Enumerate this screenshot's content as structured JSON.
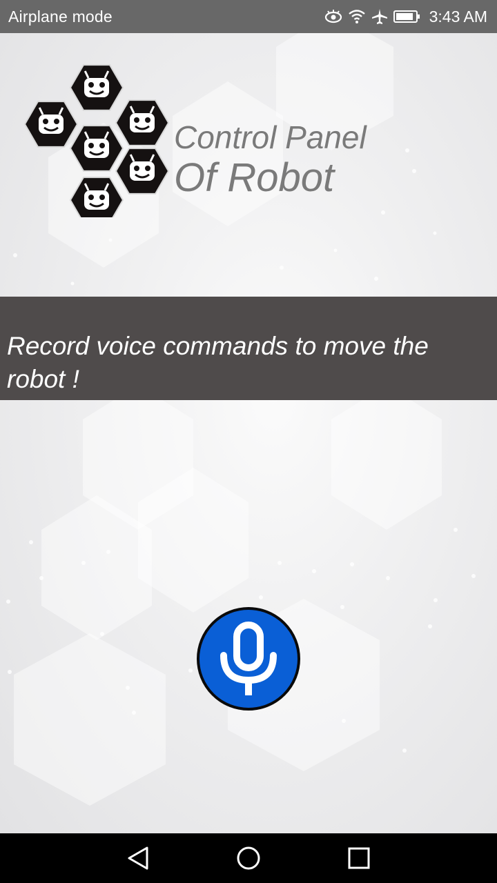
{
  "status_bar": {
    "left_text": "Airplane mode",
    "time": "3:43 AM",
    "icons": [
      "eye-icon",
      "wifi-icon",
      "airplane-icon",
      "battery-icon"
    ]
  },
  "header": {
    "logo_icon": "robot-hexagon-logo-icon",
    "title_line1": "Control Panel",
    "title_line2": "Of Robot"
  },
  "banner": {
    "text": "Record voice commands to move the robot !"
  },
  "mic": {
    "icon": "microphone-icon",
    "color": "#0a5fd6"
  },
  "nav": {
    "back_icon": "back-icon",
    "home_icon": "home-icon",
    "recent_icon": "recent-apps-icon"
  },
  "colors": {
    "status_bar": "#686868",
    "banner": "#4f4b4b",
    "title_text": "#7a7a7a",
    "nav_bar": "#000000"
  }
}
